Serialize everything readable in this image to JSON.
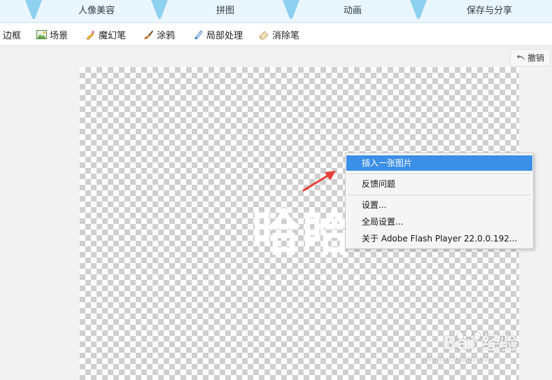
{
  "top_tabs": [
    {
      "label": "人像美容"
    },
    {
      "label": "拼图"
    },
    {
      "label": "动画"
    },
    {
      "label": "保存与分享"
    }
  ],
  "toolbar": {
    "items": [
      {
        "label": "边框",
        "icon": "frame-icon"
      },
      {
        "label": "场景",
        "icon": "scene-icon"
      },
      {
        "label": "魔幻笔",
        "icon": "magic-pen-icon"
      },
      {
        "label": "涂鸦",
        "icon": "brush-icon"
      },
      {
        "label": "局部处理",
        "icon": "local-edit-icon"
      },
      {
        "label": "消除笔",
        "icon": "eraser-icon"
      }
    ],
    "undo_label": "撤销"
  },
  "canvas": {
    "text": "哈哈"
  },
  "context_menu": {
    "items": [
      {
        "label": "插入一张图片",
        "highlighted": true
      },
      {
        "label": "反馈问题"
      },
      {
        "label": "设置..."
      },
      {
        "label": "全局设置..."
      },
      {
        "label": "关于 Adobe Flash Player 22.0.0.192..."
      }
    ]
  },
  "watermark": {
    "text": "Bai 经验",
    "sub": "jingyan.baidu.com"
  },
  "colors": {
    "menu_highlight": "#3b8fe6",
    "arrow": "#e8403a"
  }
}
